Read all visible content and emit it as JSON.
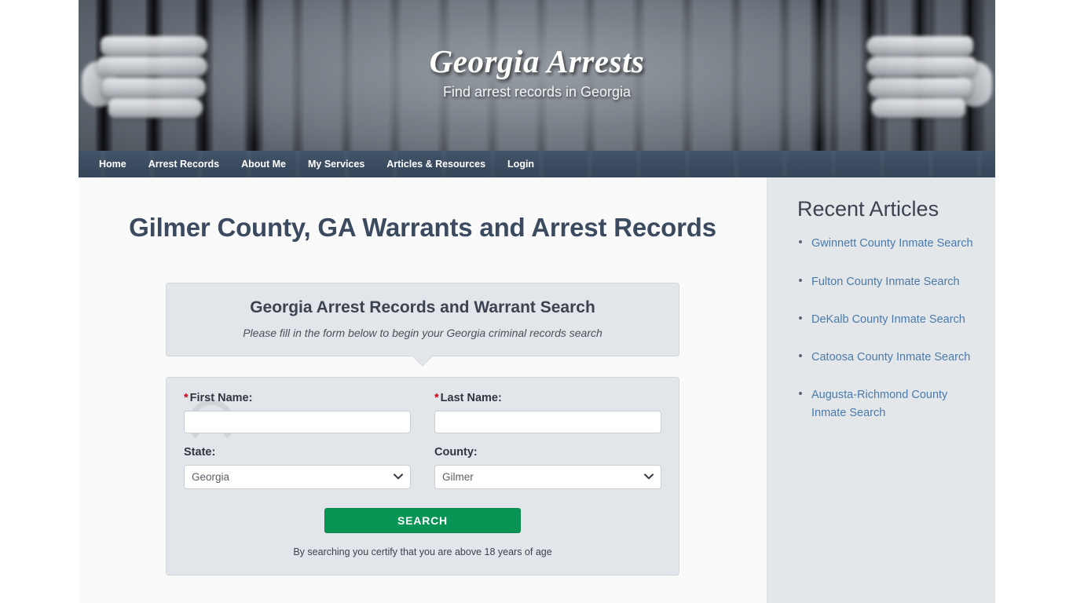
{
  "site": {
    "title": "Georgia Arrests",
    "tagline": "Find arrest records in Georgia"
  },
  "nav": {
    "items": [
      {
        "label": "Home"
      },
      {
        "label": "Arrest Records"
      },
      {
        "label": "About Me"
      },
      {
        "label": "My Services"
      },
      {
        "label": "Articles & Resources"
      },
      {
        "label": "Login"
      }
    ]
  },
  "main": {
    "page_title": "Gilmer County, GA Warrants and Arrest Records",
    "callout": {
      "heading": "Georgia Arrest Records and Warrant Search",
      "subtext": "Please fill in the form below to begin your Georgia criminal records search"
    },
    "form": {
      "first_name": {
        "required_mark": "*",
        "label": "First Name:",
        "value": "",
        "placeholder": ""
      },
      "last_name": {
        "required_mark": "*",
        "label": "Last Name:",
        "value": "",
        "placeholder": ""
      },
      "state": {
        "label": "State:",
        "selected": "Georgia",
        "options": [
          "Georgia"
        ]
      },
      "county": {
        "label": "County:",
        "selected": "Gilmer",
        "options": [
          "Gilmer"
        ]
      },
      "submit_label": "SEARCH",
      "disclaimer": "By searching you certify that you are above 18 years of age"
    }
  },
  "sidebar": {
    "title": "Recent Articles",
    "articles": [
      {
        "label": "Gwinnett County Inmate Search"
      },
      {
        "label": "Fulton County Inmate Search"
      },
      {
        "label": "DeKalb County Inmate Search"
      },
      {
        "label": "Catoosa County Inmate Search"
      },
      {
        "label": "Augusta-Richmond County Inmate Search"
      }
    ]
  },
  "colors": {
    "nav_bg": "#3c4c60",
    "heading": "#3b4a5f",
    "panel_bg": "#e2e5e9",
    "sidebar_bg": "#e4e7ea",
    "link": "#4a7aaa",
    "submit_green": "#089454",
    "required_red": "#d0021b"
  }
}
